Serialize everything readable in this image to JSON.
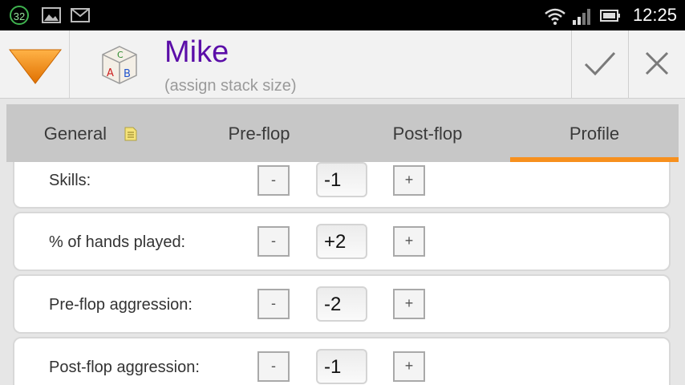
{
  "status_bar": {
    "notification_count": "32",
    "time": "12:25",
    "icons": [
      "notification-count-icon",
      "image-icon",
      "mail-icon",
      "wifi-icon",
      "signal-icon",
      "battery-icon"
    ]
  },
  "action_bar": {
    "title": "Mike",
    "subtitle": "(assign stack size)",
    "icons": [
      "dropdown-menu-icon",
      "abc-blocks-icon",
      "check-icon",
      "close-icon"
    ],
    "accent_color": "#f7901e",
    "title_color": "#5b0ea8"
  },
  "tabs": [
    {
      "label": "General",
      "icon": "notes-icon"
    },
    {
      "label": "Pre-flop"
    },
    {
      "label": "Post-flop"
    },
    {
      "label": "Profile",
      "active": true
    }
  ],
  "profile_rows": [
    {
      "label": "Skills:",
      "value": "-1",
      "minus": "-",
      "plus": "+"
    },
    {
      "label": "% of hands played:",
      "value": "+2",
      "minus": "-",
      "plus": "+"
    },
    {
      "label": "Pre-flop aggression:",
      "value": "-2",
      "minus": "-",
      "plus": "+"
    },
    {
      "label": "Post-flop aggression:",
      "value": "-1",
      "minus": "-",
      "plus": "+"
    }
  ]
}
